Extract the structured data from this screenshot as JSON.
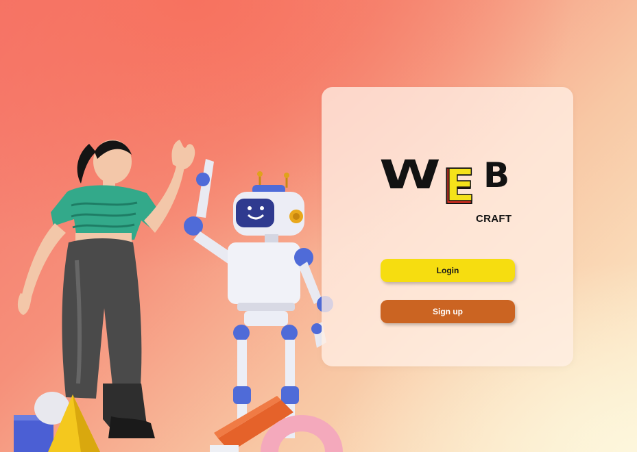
{
  "logo": {
    "word": "WEB",
    "letters": [
      "W",
      "E",
      "B"
    ],
    "sub": "CRAFT"
  },
  "buttons": {
    "login": "Login",
    "signup": "Sign up"
  },
  "colors": {
    "background_top": "#f5746a",
    "background_bottom": "#fcefcd",
    "card": "#ffeee4",
    "login_button": "#f6dd10",
    "signup_button": "#cb6422",
    "logo_e": "#f5e21a",
    "logo_e_outline": "#e53022"
  },
  "illustration": {
    "characters": [
      "woman-figure",
      "robot-figure"
    ]
  }
}
